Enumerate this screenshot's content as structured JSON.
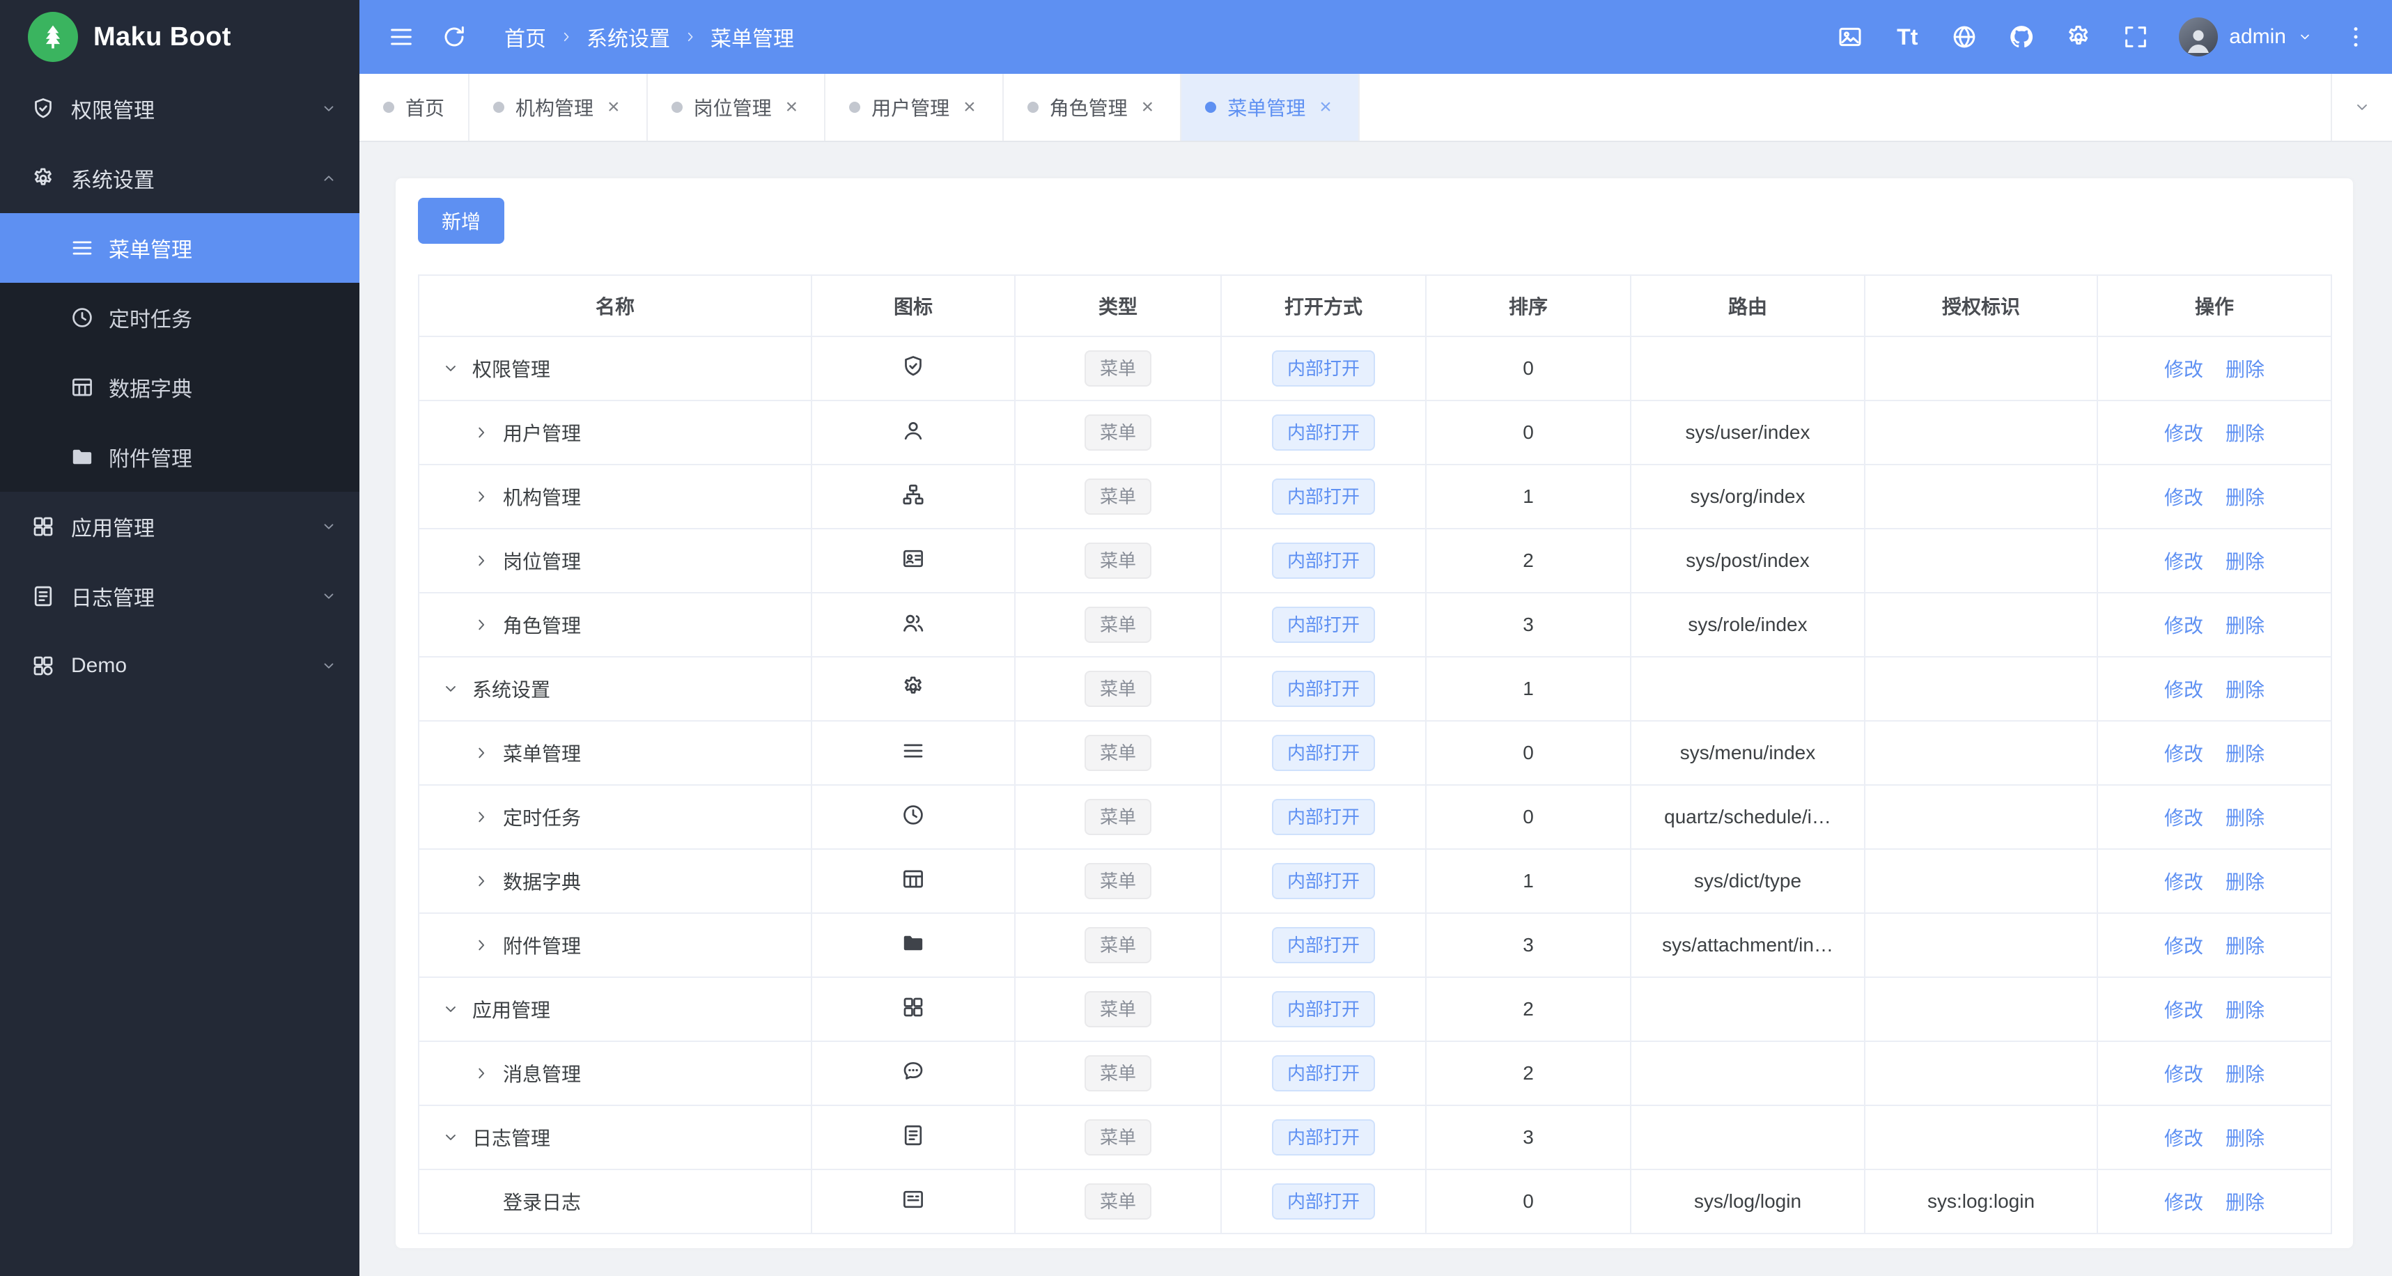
{
  "theme": {
    "primary": "#5e90f2"
  },
  "sidebar": {
    "logo_text": "Maku Boot",
    "logo_icon": "tree",
    "items": [
      {
        "label": "权限管理",
        "icon": "shield",
        "state": "collapsed"
      },
      {
        "label": "系统设置",
        "icon": "gear",
        "state": "expanded",
        "children": [
          {
            "label": "菜单管理",
            "icon": "menu",
            "active": true
          },
          {
            "label": "定时任务",
            "icon": "clock",
            "active": false
          },
          {
            "label": "数据字典",
            "icon": "dict",
            "active": false
          },
          {
            "label": "附件管理",
            "icon": "folder",
            "active": false
          }
        ]
      },
      {
        "label": "应用管理",
        "icon": "apps",
        "state": "collapsed"
      },
      {
        "label": "日志管理",
        "icon": "log",
        "state": "collapsed"
      },
      {
        "label": "Demo",
        "icon": "demo",
        "state": "collapsed"
      }
    ]
  },
  "header": {
    "left_icons": [
      "collapse-menu",
      "refresh"
    ],
    "breadcrumb": [
      "首页",
      "系统设置",
      "菜单管理"
    ],
    "right_icons": [
      "screenshot",
      "font-size",
      "globe",
      "github",
      "settings",
      "fullscreen"
    ],
    "username": "admin"
  },
  "tabbar": {
    "tabs": [
      {
        "label": "首页",
        "closable": false,
        "active": false
      },
      {
        "label": "机构管理",
        "closable": true,
        "active": false
      },
      {
        "label": "岗位管理",
        "closable": true,
        "active": false
      },
      {
        "label": "用户管理",
        "closable": true,
        "active": false
      },
      {
        "label": "角色管理",
        "closable": true,
        "active": false
      },
      {
        "label": "菜单管理",
        "closable": true,
        "active": true
      }
    ]
  },
  "toolbar": {
    "add_label": "新增"
  },
  "table": {
    "columns": [
      "名称",
      "图标",
      "类型",
      "打开方式",
      "排序",
      "路由",
      "授权标识",
      "操作"
    ],
    "actions": {
      "edit": "修改",
      "delete": "删除"
    },
    "rows": [
      {
        "name": "权限管理",
        "icon": "shield",
        "level": 0,
        "expand": "expanded",
        "type": "菜单",
        "open": "内部打开",
        "sort": "0",
        "route": "",
        "auth": ""
      },
      {
        "name": "用户管理",
        "icon": "user",
        "level": 1,
        "expand": "collapsed",
        "type": "菜单",
        "open": "内部打开",
        "sort": "0",
        "route": "sys/user/index",
        "auth": ""
      },
      {
        "name": "机构管理",
        "icon": "org",
        "level": 1,
        "expand": "collapsed",
        "type": "菜单",
        "open": "内部打开",
        "sort": "1",
        "route": "sys/org/index",
        "auth": ""
      },
      {
        "name": "岗位管理",
        "icon": "post",
        "level": 1,
        "expand": "collapsed",
        "type": "菜单",
        "open": "内部打开",
        "sort": "2",
        "route": "sys/post/index",
        "auth": ""
      },
      {
        "name": "角色管理",
        "icon": "role",
        "level": 1,
        "expand": "collapsed",
        "type": "菜单",
        "open": "内部打开",
        "sort": "3",
        "route": "sys/role/index",
        "auth": ""
      },
      {
        "name": "系统设置",
        "icon": "gear",
        "level": 0,
        "expand": "expanded",
        "type": "菜单",
        "open": "内部打开",
        "sort": "1",
        "route": "",
        "auth": ""
      },
      {
        "name": "菜单管理",
        "icon": "menu",
        "level": 1,
        "expand": "collapsed",
        "type": "菜单",
        "open": "内部打开",
        "sort": "0",
        "route": "sys/menu/index",
        "auth": ""
      },
      {
        "name": "定时任务",
        "icon": "clock",
        "level": 1,
        "expand": "collapsed",
        "type": "菜单",
        "open": "内部打开",
        "sort": "0",
        "route": "quartz/schedule/i…",
        "auth": ""
      },
      {
        "name": "数据字典",
        "icon": "dict",
        "level": 1,
        "expand": "collapsed",
        "type": "菜单",
        "open": "内部打开",
        "sort": "1",
        "route": "sys/dict/type",
        "auth": ""
      },
      {
        "name": "附件管理",
        "icon": "folder",
        "level": 1,
        "expand": "collapsed",
        "type": "菜单",
        "open": "内部打开",
        "sort": "3",
        "route": "sys/attachment/in…",
        "auth": ""
      },
      {
        "name": "应用管理",
        "icon": "apps",
        "level": 0,
        "expand": "expanded",
        "type": "菜单",
        "open": "内部打开",
        "sort": "2",
        "route": "",
        "auth": ""
      },
      {
        "name": "消息管理",
        "icon": "message",
        "level": 1,
        "expand": "collapsed",
        "type": "菜单",
        "open": "内部打开",
        "sort": "2",
        "route": "",
        "auth": ""
      },
      {
        "name": "日志管理",
        "icon": "log",
        "level": 0,
        "expand": "expanded",
        "type": "菜单",
        "open": "内部打开",
        "sort": "3",
        "route": "",
        "auth": ""
      },
      {
        "name": "登录日志",
        "icon": "login",
        "level": 1,
        "expand": "none",
        "type": "菜单",
        "open": "内部打开",
        "sort": "0",
        "route": "sys/log/login",
        "auth": "sys:log:login"
      }
    ]
  }
}
